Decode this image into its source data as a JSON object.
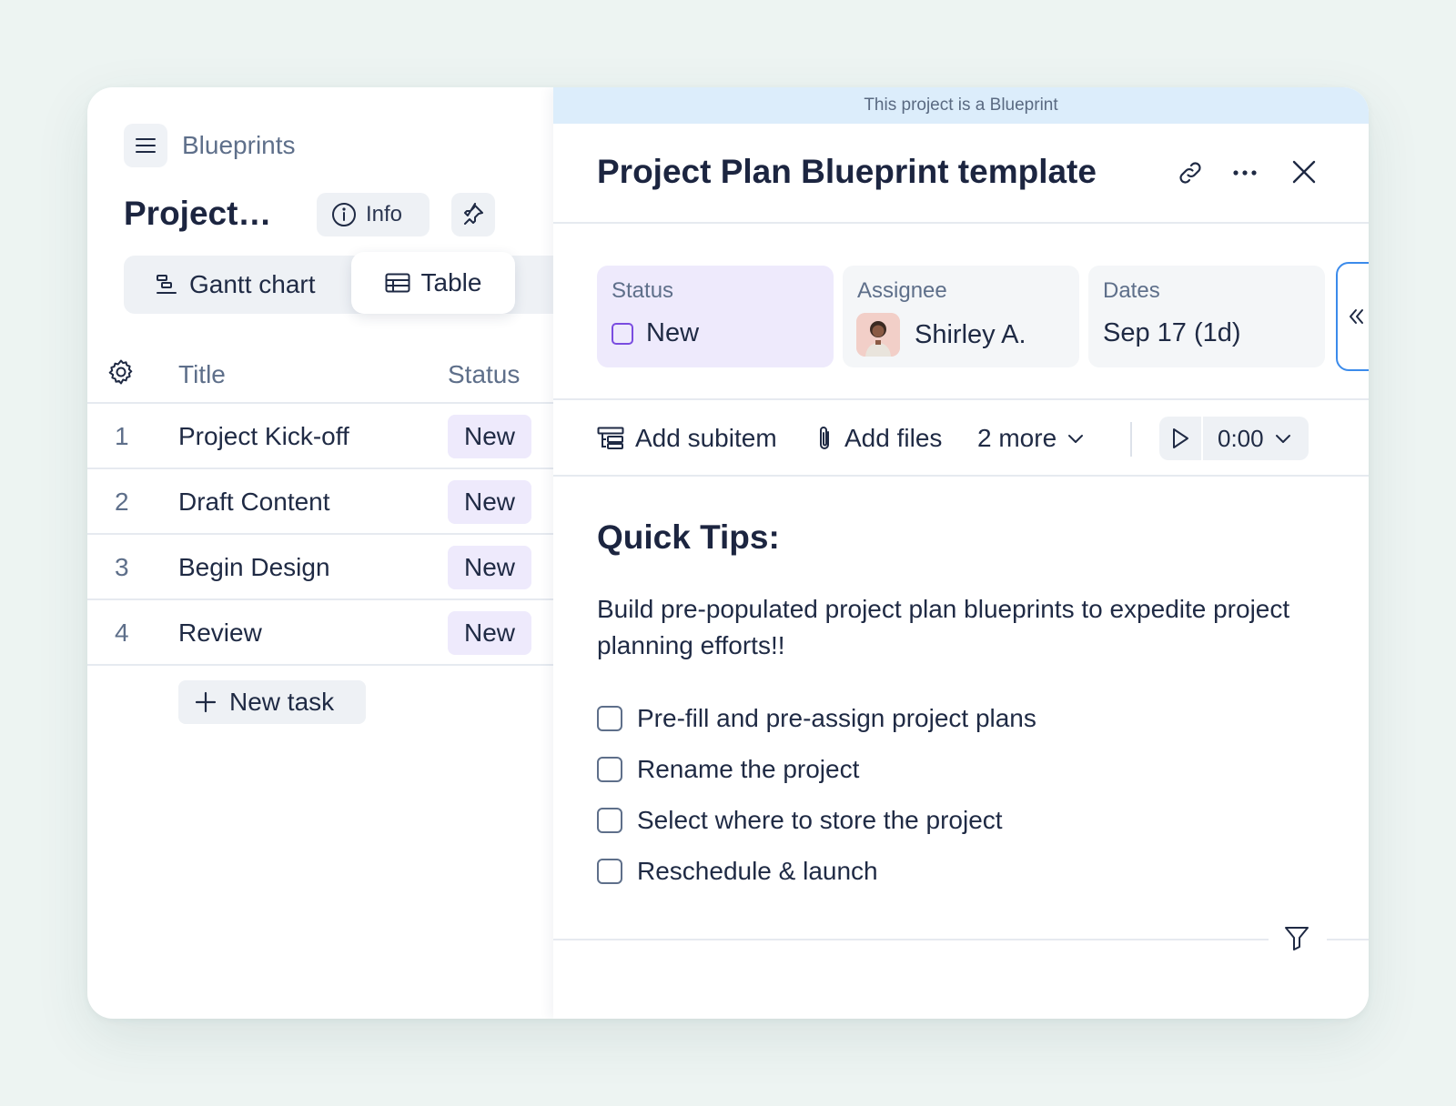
{
  "breadcrumb": {
    "label": "Blueprints"
  },
  "project": {
    "title_truncated": "Project…",
    "info_label": "Info"
  },
  "views": {
    "gantt_label": "Gantt chart",
    "table_label": "Table"
  },
  "table": {
    "headers": {
      "title": "Title",
      "status": "Status"
    },
    "rows": [
      {
        "num": "1",
        "title": "Project Kick-off",
        "status": "New"
      },
      {
        "num": "2",
        "title": "Draft Content",
        "status": "New"
      },
      {
        "num": "3",
        "title": "Begin Design",
        "status": "New"
      },
      {
        "num": "4",
        "title": "Review",
        "status": "New"
      }
    ],
    "new_task_label": "New task"
  },
  "detail": {
    "banner": "This project is a Blueprint",
    "title": "Project Plan Blueprint template",
    "fields": {
      "status": {
        "label": "Status",
        "value": "New"
      },
      "assignee": {
        "label": "Assignee",
        "value": "Shirley A."
      },
      "dates": {
        "label": "Dates",
        "value": "Sep 17 (1d)"
      }
    },
    "toolbar": {
      "add_subitem": "Add subitem",
      "add_files": "Add files",
      "more": "2 more",
      "timer": "0:00"
    },
    "tips_title": "Quick Tips:",
    "tips_body": "Build pre-populated project plan blueprints to expedite project planning efforts!!",
    "checklist": [
      "Pre-fill and pre-assign project plans",
      "Rename the project",
      "Select where to store the project",
      "Reschedule & launch"
    ]
  },
  "colors": {
    "page_bg": "#edf4f2",
    "banner_bg": "#dcedfb",
    "status_badge_bg": "#eeeafc",
    "status_checkbox": "#7a4ce0",
    "expand_tab_border": "#3b8beb"
  }
}
